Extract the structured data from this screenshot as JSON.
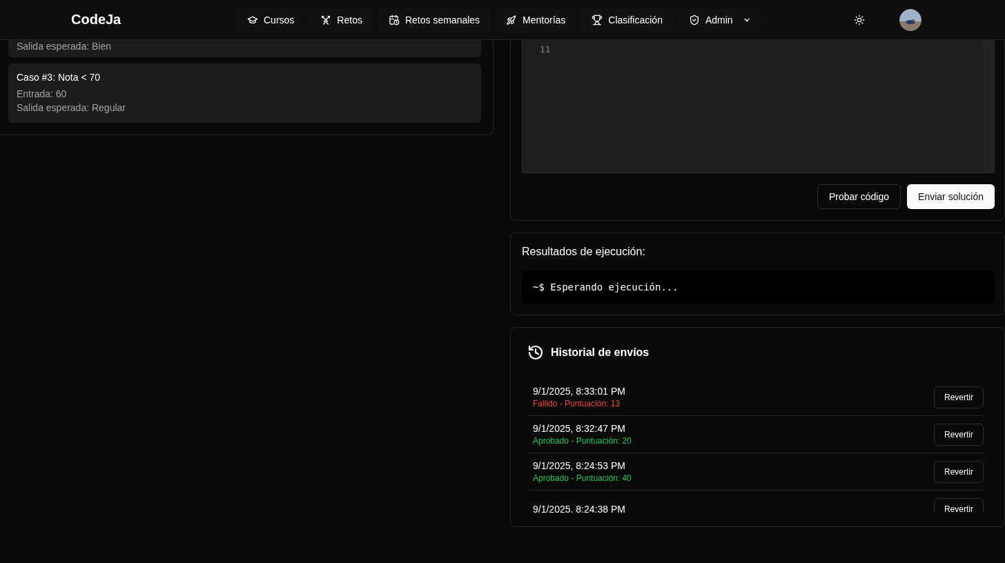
{
  "header": {
    "logo": "CodeJa",
    "nav": [
      {
        "label": "Cursos"
      },
      {
        "label": "Retos"
      },
      {
        "label": "Retos semanales"
      },
      {
        "label": "Mentorías"
      },
      {
        "label": "Clasificación"
      },
      {
        "label": "Admin",
        "dropdown": true
      }
    ]
  },
  "test_cases": [
    {
      "lines": [
        {
          "label": "Salida esperada:",
          "value": "Bien"
        }
      ]
    },
    {
      "title": "Caso #3: Nota < 70",
      "lines": [
        {
          "label": "Entrada:",
          "value": "60"
        },
        {
          "label": "Salida esperada:",
          "value": "Regular"
        }
      ]
    }
  ],
  "editor": {
    "line_numbers": [
      "11"
    ]
  },
  "actions": [
    {
      "label": "Probar código",
      "kind": "secondary"
    },
    {
      "label": "Enviar solución",
      "kind": "primary"
    }
  ],
  "results": {
    "title": "Resultados de ejecución:",
    "console": "~$ Esperando ejecución..."
  },
  "history": {
    "title": "Historial de envíos",
    "items": [
      {
        "time": "9/1/2025, 8:33:01 PM",
        "status": "Fallido - Puntuación: 13",
        "kind": "failed",
        "revert_label": "Revertir"
      },
      {
        "time": "9/1/2025, 8:32:47 PM",
        "status": "Aprobado - Puntuación: 20",
        "kind": "passed",
        "revert_label": "Revertir"
      },
      {
        "time": "9/1/2025, 8:24:53 PM",
        "status": "Aprobado - Puntuación: 40",
        "kind": "passed",
        "revert_label": "Revertir"
      },
      {
        "time": "9/1/2025, 8:24:38 PM",
        "revert_label": "Revertir"
      }
    ]
  }
}
